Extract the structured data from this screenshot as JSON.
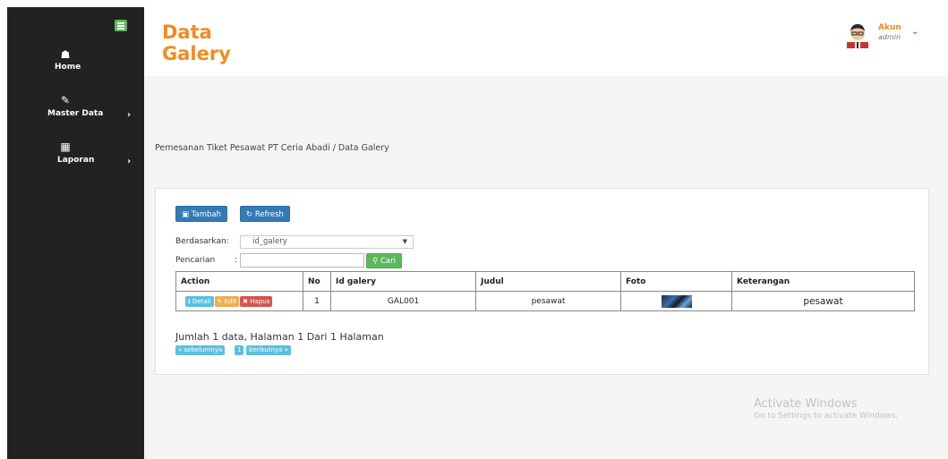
{
  "header": {
    "title_line1": "Data",
    "title_line2": "Galery"
  },
  "user": {
    "name": "Akun",
    "role": "admin"
  },
  "sidebar": {
    "items": [
      {
        "label": "Home",
        "icon": "home-icon"
      },
      {
        "label": "Master Data",
        "icon": "edit-icon"
      },
      {
        "label": "Laporan",
        "icon": "calendar-icon"
      }
    ]
  },
  "breadcrumb": "Pemesanan Tiket Pesawat PT Ceria Abadi / Data Galery",
  "toolbar": {
    "add_label": "Tambah",
    "refresh_label": "Refresh"
  },
  "filter": {
    "by_label": "Berdasarkan:",
    "by_value": "id_galery",
    "search_label": "Pencarian",
    "search_colon": ":",
    "search_value": "",
    "search_button": "Cari"
  },
  "table": {
    "columns": [
      "Action",
      "No",
      "Id galery",
      "Judul",
      "Foto",
      "Keterangan"
    ],
    "rows": [
      {
        "no": "1",
        "id": "GAL001",
        "judul": "pesawat",
        "keterangan": "pesawat"
      }
    ],
    "actions": {
      "detail": "Detail",
      "edit": "Edit",
      "delete": "Hapus"
    }
  },
  "pagination": {
    "summary": "Jumlah 1 data, Halaman 1 Dari 1 Halaman",
    "prev": "« sebelumnya",
    "page": "1",
    "next": "berikutnya »"
  },
  "watermark": {
    "line1": "Activate Windows",
    "line2": "Go to Settings to activate Windows."
  },
  "colors": {
    "accent": "#f58a1f",
    "sidebar": "#222222",
    "primary": "#337ab7",
    "success": "#5cb85c"
  }
}
